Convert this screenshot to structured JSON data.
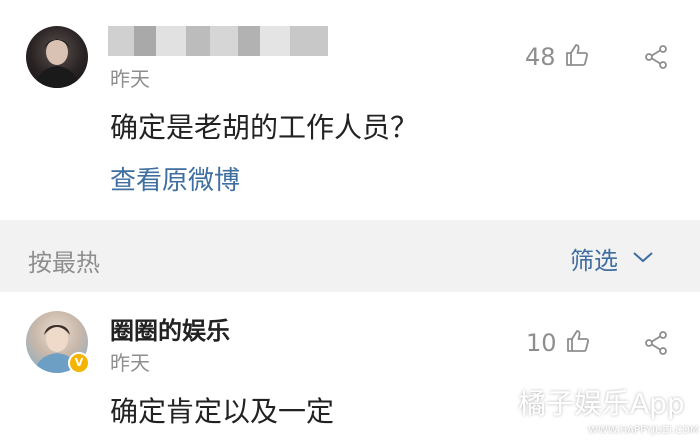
{
  "comments": [
    {
      "time": "昨天",
      "text": "确定是老胡的工作人员？",
      "likes": "48",
      "view_original": "查看原微博"
    },
    {
      "username": "圈圈的娱乐",
      "badge": "V",
      "time": "昨天",
      "text": "确定肯定以及一定",
      "likes": "10"
    }
  ],
  "sort": {
    "label": "按最热",
    "filter_label": "筛选"
  },
  "watermark": {
    "text": "橘子娱乐App",
    "url": "WWW.HAPPYJUZI.COM"
  },
  "colors": {
    "link": "#3f6ea0",
    "muted": "#8e8e8e",
    "text": "#222222",
    "background": "#f2f2f2",
    "card": "#ffffff",
    "vip": "#f5b400"
  },
  "icons": [
    "thumbs-up-icon",
    "share-icon",
    "chevron-down-icon"
  ]
}
